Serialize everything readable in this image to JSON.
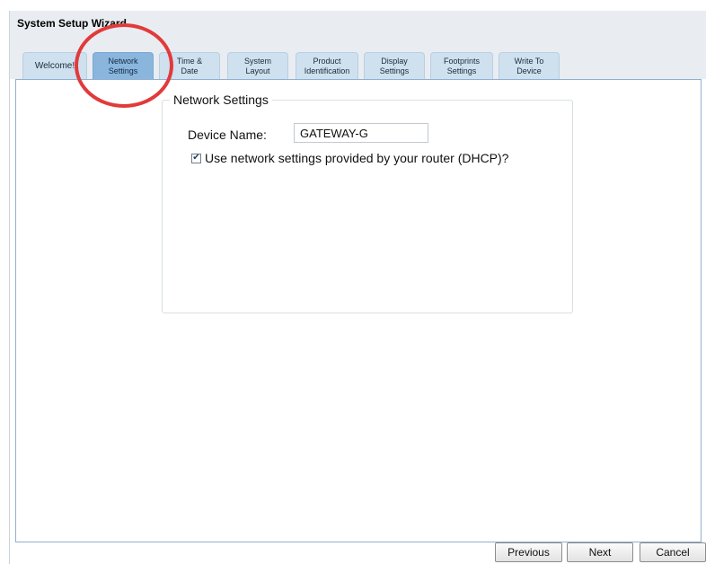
{
  "window": {
    "title": "System Setup Wizard"
  },
  "tabs": [
    {
      "label": "Welcome!",
      "active": false
    },
    {
      "label": "Network\nSettings",
      "active": true
    },
    {
      "label": "Time &\nDate",
      "active": false
    },
    {
      "label": "System\nLayout",
      "active": false
    },
    {
      "label": "Product\nIdentification",
      "active": false
    },
    {
      "label": "Display\nSettings",
      "active": false
    },
    {
      "label": "Footprints\nSettings",
      "active": false
    },
    {
      "label": "Write To\nDevice",
      "active": false
    }
  ],
  "network": {
    "legend": "Network Settings",
    "device_name_label": "Device Name:",
    "device_name_value": "GATEWAY-G",
    "dhcp_label": "Use network settings provided by your router (DHCP)?",
    "dhcp_checked": true
  },
  "buttons": {
    "previous": "Previous",
    "next": "Next",
    "cancel": "Cancel"
  },
  "colors": {
    "active_tab": "#8ab6de",
    "tab": "#cfe0ef",
    "annotation": "#e23a3a"
  }
}
